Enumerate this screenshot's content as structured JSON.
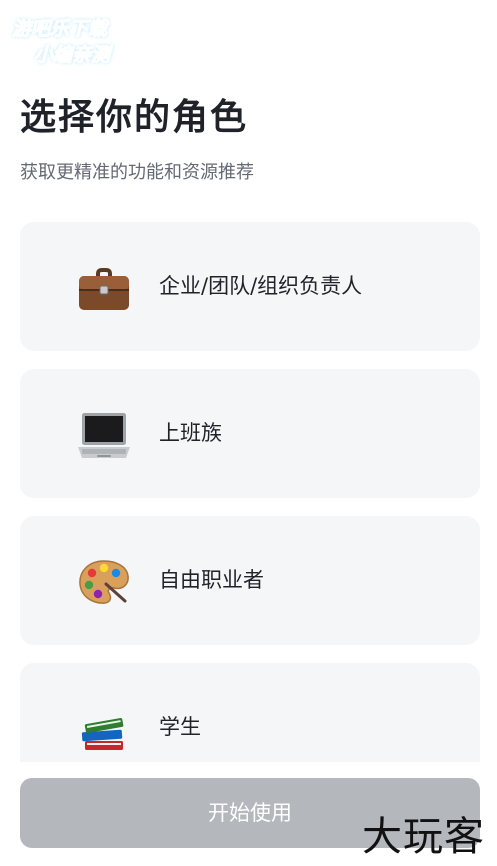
{
  "watermark_top": {
    "line1": "游吧乐下载",
    "line2": "小编亲测"
  },
  "header": {
    "title": "选择你的角色",
    "subtitle": "获取更精准的功能和资源推荐"
  },
  "roles": [
    {
      "label": "企业/团队/组织负责人",
      "icon": "briefcase-icon"
    },
    {
      "label": "上班族",
      "icon": "laptop-icon"
    },
    {
      "label": "自由职业者",
      "icon": "palette-icon"
    },
    {
      "label": "学生",
      "icon": "books-icon"
    }
  ],
  "footer": {
    "start_label": "开始使用"
  },
  "watermark_bottom": "大玩客",
  "colors": {
    "card_bg": "#f5f6f7",
    "button_disabled_bg": "#b4b7bc",
    "title_text": "#1f2329",
    "subtitle_text": "#646a73"
  }
}
